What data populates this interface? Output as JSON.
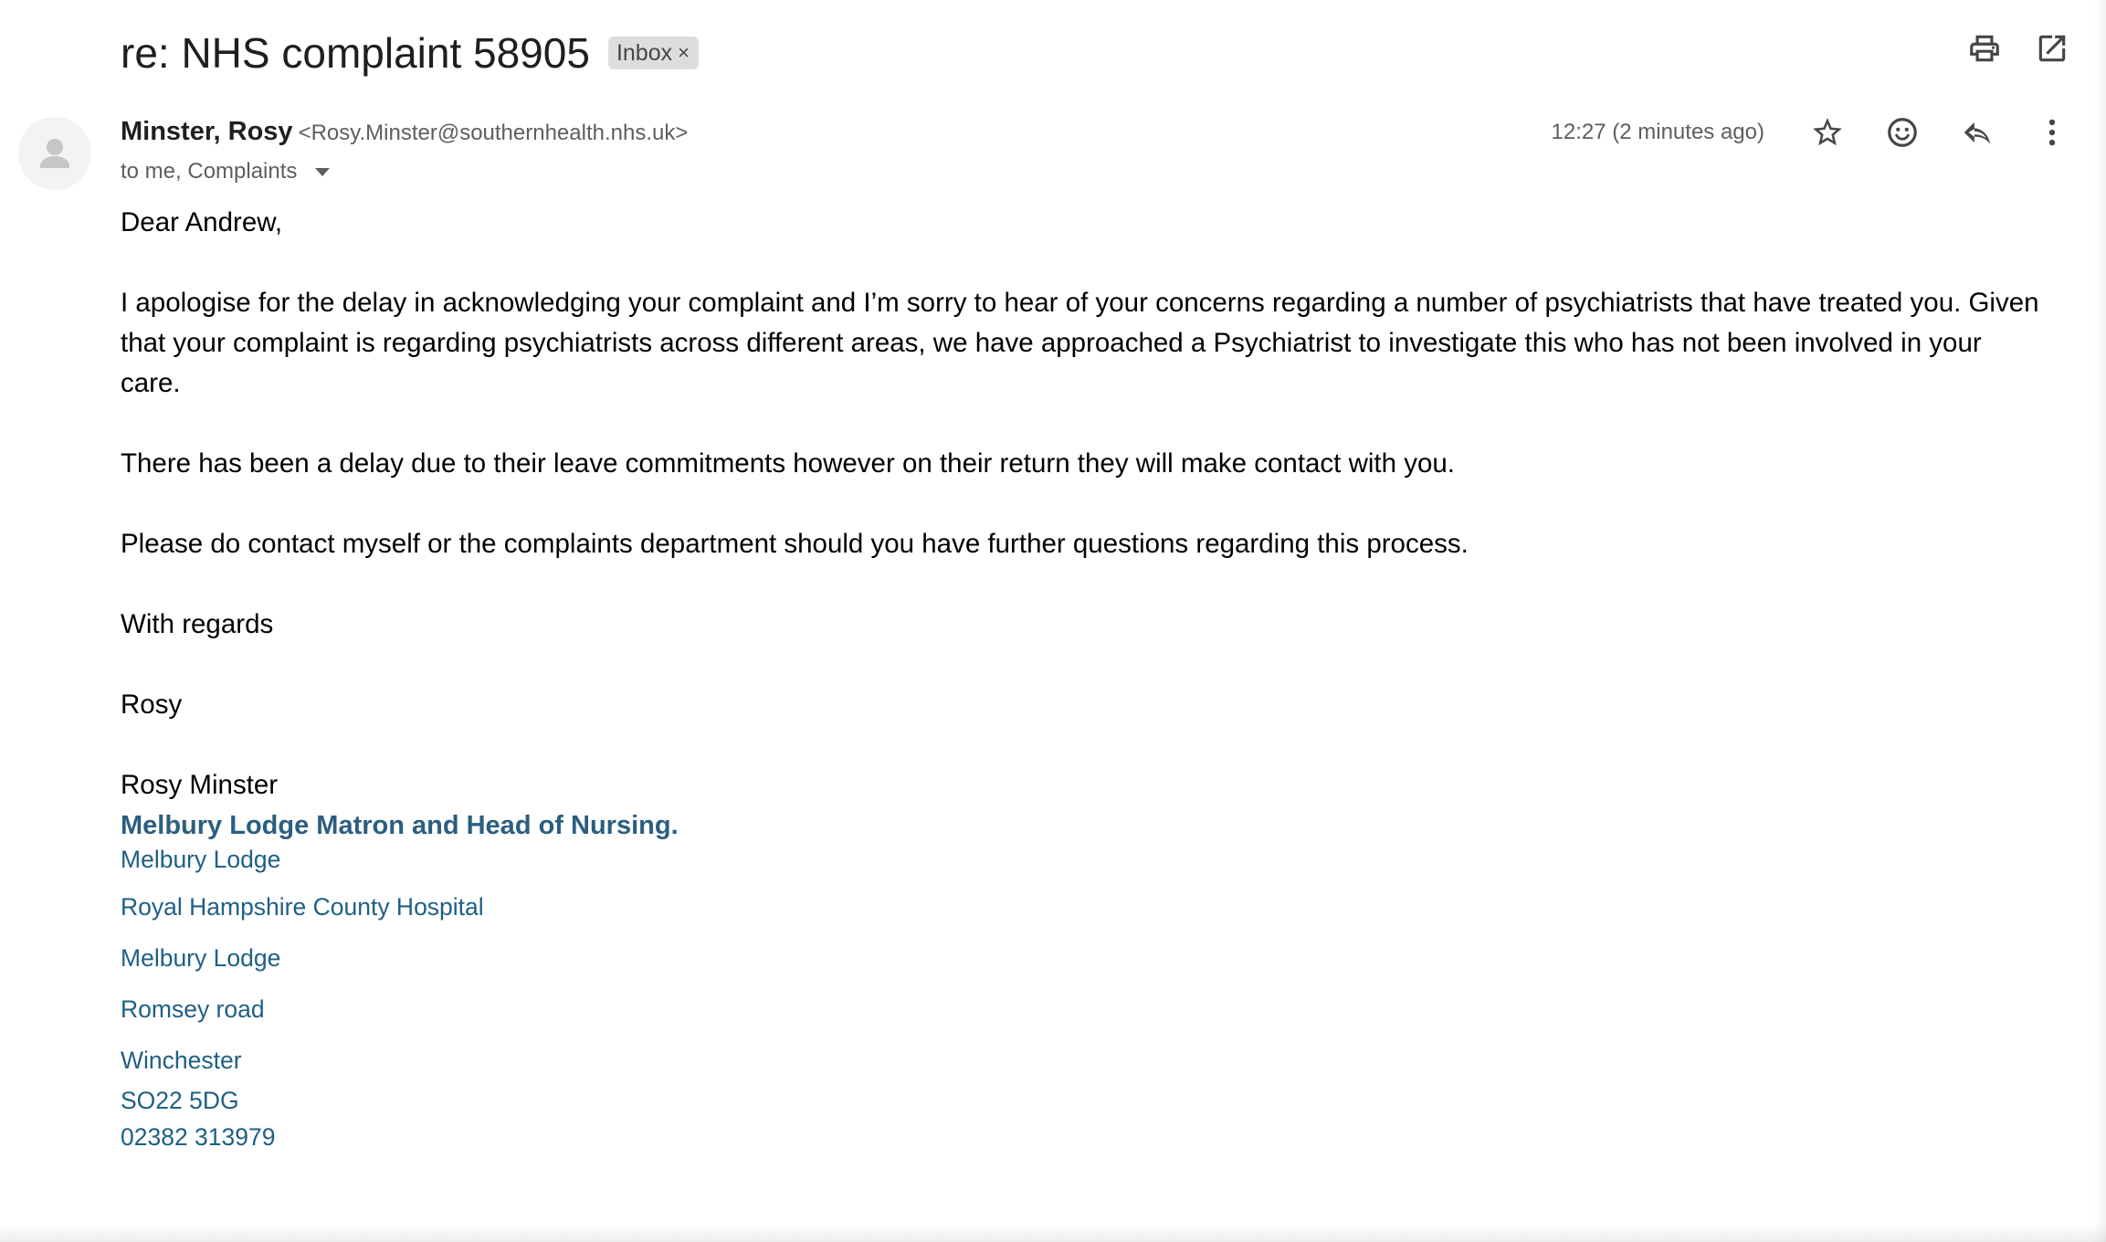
{
  "subject": "re: NHS complaint 58905",
  "label": {
    "text": "Inbox",
    "remove": "×"
  },
  "sender": {
    "name": "Minster, Rosy",
    "email": "<Rosy.Minster@southernhealth.nhs.uk>",
    "recipients": "to me, Complaints"
  },
  "timestamp": "12:27 (2 minutes ago)",
  "icons": {
    "print": "print-icon",
    "open_new": "open-in-new-window-icon",
    "star": "star-icon",
    "emoji": "emoji-reaction-icon",
    "reply": "reply-icon",
    "more": "more-vertical-icon",
    "avatar": "person-icon"
  },
  "body": {
    "greeting": "Dear Andrew,",
    "p1": "I apologise for the delay in acknowledging your complaint and I’m sorry to hear of your concerns regarding  a number of psychiatrists that have treated you.  Given that your complaint is regarding psychiatrists across different areas, we have approached a Psychiatrist to investigate this who has not been involved in your care.",
    "p2": "There has been a delay due to their leave commitments however on their return they will make contact with you.",
    "p3": "Please do contact myself or the complaints department should you have further questions regarding this process.",
    "closing": "With regards",
    "signoff": "Rosy"
  },
  "signature": {
    "name": "Rosy Minster",
    "title": "Melbury Lodge Matron and Head of Nursing.",
    "address": [
      "Melbury Lodge",
      "Royal Hampshire County Hospital",
      "Melbury Lodge",
      "Romsey road",
      "Winchester",
      "SO22 5DG",
      "02382 313979"
    ]
  },
  "colors": {
    "signature_title": "#2b5e80",
    "signature_address": "#1f5f85",
    "chip_background": "#dddddd"
  }
}
